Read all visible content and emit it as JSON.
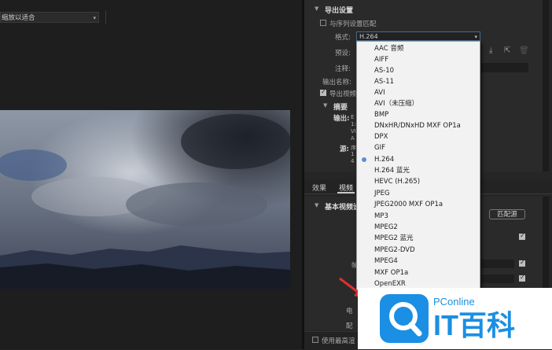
{
  "preview": {
    "zoom_value": "缩放以适合"
  },
  "export_settings": {
    "section_title": "导出设置",
    "match_sequence_label": "与序列设置匹配",
    "format_label": "格式:",
    "format_value": "H.264",
    "preset_label": "预设:",
    "comment_label": "注释:",
    "output_name_label": "输出名称:",
    "export_video_label": "导出视频",
    "summary_title": "摘要",
    "summary_output_label": "输出:",
    "summary_source_label": "源:",
    "summary_output_fragments": [
      "E",
      "1:",
      "VI",
      "A"
    ],
    "summary_source_fragments": [
      "序",
      "1",
      "4"
    ]
  },
  "format_options": [
    "AAC 音频",
    "AIFF",
    "AS-10",
    "AS-11",
    "AVI",
    "AVI（未压缩）",
    "BMP",
    "DNxHR/DNxHD MXF OP1a",
    "DPX",
    "GIF",
    "H.264",
    "H.264 蓝光",
    "HEVC (H.265)",
    "JPEG",
    "JPEG2000 MXF OP1a",
    "MP3",
    "MPEG2",
    "MPEG2 蓝光",
    "MPEG2-DVD",
    "MPEG4",
    "MXF OP1a",
    "OpenEXR"
  ],
  "selected_format_index": 10,
  "tabs": {
    "effects": "效果",
    "video": "视频"
  },
  "basic_video": {
    "title": "基本视频设",
    "match_button": "匹配源",
    "frame_label": "帧",
    "field_label": "电",
    "profile_label": "配"
  },
  "footer": {
    "max_quality_label": "使用最高渲"
  },
  "watermark": {
    "brand": "PConline",
    "cn": "IT百科"
  },
  "colors": {
    "accent_blue": "#5a8fd6",
    "watermark_blue": "#1a8fe3",
    "arrow_red": "#e0302a"
  }
}
